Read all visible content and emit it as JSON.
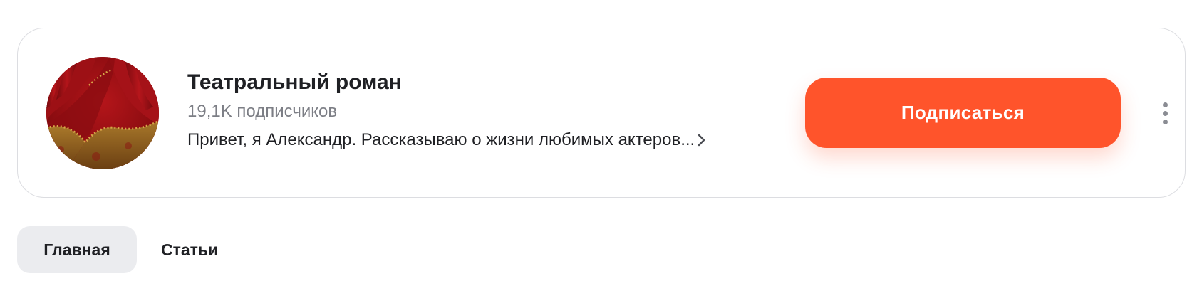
{
  "channel": {
    "title": "Театральный роман",
    "subscribers": "19,1K подписчиков",
    "description": "Привет, я Александр. Рассказываю о жизни любимых актеров...",
    "avatar_icon": "theater-curtain-avatar",
    "subscribe_label": "Подписаться",
    "more_icon": "more-vertical-icon"
  },
  "tabs": [
    {
      "label": "Главная",
      "active": true
    },
    {
      "label": "Статьи",
      "active": false
    }
  ],
  "colors": {
    "accent": "#ff542b",
    "text_primary": "#1f2024",
    "text_secondary": "#7c7e85",
    "tab_active_bg": "#ebecef",
    "card_border": "#dcdde1"
  }
}
